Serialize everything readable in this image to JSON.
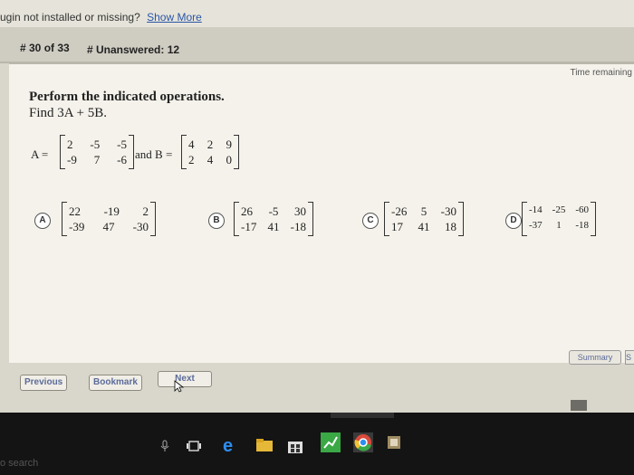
{
  "plugin_bar": {
    "message": "ugin not installed or missing?",
    "link": "Show More"
  },
  "nav": {
    "question_count": "# 30 of 33",
    "unanswered": "# Unanswered: 12"
  },
  "panel": {
    "time_remaining": "Time remaining",
    "instruction": "Perform the indicated operations.",
    "subinstruction": "Find 3A + 5B.",
    "matrix_a_label": "A =",
    "and_b_label": "and B =",
    "matrix_a": [
      [
        "2",
        "-5",
        "-5"
      ],
      [
        "-9",
        "7",
        "-6"
      ]
    ],
    "matrix_b": [
      [
        "4",
        "2",
        "9"
      ],
      [
        "2",
        "4",
        "0"
      ]
    ]
  },
  "choices": [
    {
      "letter": "A",
      "rows": [
        [
          "22",
          "-19",
          "2"
        ],
        [
          "-39",
          "47",
          "-30"
        ]
      ]
    },
    {
      "letter": "B",
      "rows": [
        [
          "26",
          "-5",
          "30"
        ],
        [
          "-17",
          "41",
          "-18"
        ]
      ]
    },
    {
      "letter": "C",
      "rows": [
        [
          "-26",
          "5",
          "-30"
        ],
        [
          "17",
          "41",
          "18"
        ]
      ]
    },
    {
      "letter": "D",
      "rows": [
        [
          "-14",
          "-25",
          "-60"
        ],
        [
          "-37",
          "1",
          "-18"
        ]
      ]
    }
  ],
  "buttons": {
    "summary": "Summary",
    "summary_cut": "S",
    "previous": "Previous",
    "bookmark": "Bookmark",
    "next": "Next"
  },
  "taskbar": {
    "search_text": "o search"
  },
  "colors": {
    "panel_bg": "#f4f2ea",
    "button_text": "#5c6b9a",
    "link": "#2a55a8",
    "taskbar": "#141414"
  }
}
